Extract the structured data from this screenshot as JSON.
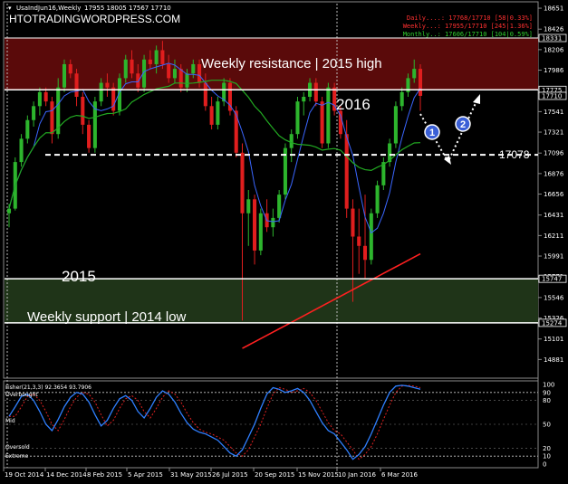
{
  "window": {
    "title": "UsaIndJun16,Weekly",
    "ohlc": "17955 18005 17567 17710",
    "watermark": "HTOTRADINGWORDPRESS.COM"
  },
  "info": [
    {
      "text": "Daily....: 17768/17710 [58|0.33%]",
      "color": "#ff3030"
    },
    {
      "text": "Weekly...: 17955/17710 [245|1.36%]",
      "color": "#ff3030"
    },
    {
      "text": "Monthly..: 17606/17710 [104|0.59%]",
      "color": "#2fd02f"
    }
  ],
  "annotations": {
    "resistance_label": "Weekly resistance | 2015 high",
    "support_label": "Weekly support | 2014 low",
    "year_2016": "2016",
    "year_2015": "2015",
    "level_label": "17078",
    "marker_1": "1",
    "marker_2": "2"
  },
  "oscillator": {
    "title": "Fisher(21,3,3) 92.3654 93.7906",
    "overbought": "Overbought",
    "mid": "Mid",
    "oversold": "Oversold",
    "extreme": "Extreme",
    "ticks": [
      "100",
      "90",
      "80",
      "50",
      "20",
      "10",
      "0"
    ]
  },
  "chart_data": {
    "type": "candlestick",
    "symbol": "UsaIndJun16",
    "timeframe": "Weekly",
    "ylim": [
      14700,
      18700
    ],
    "price_ticks": [
      18651,
      18426,
      18206,
      17986,
      17761,
      17541,
      17321,
      17096,
      16876,
      16656,
      16431,
      16211,
      15991,
      15771,
      15546,
      15326,
      15101,
      14881
    ],
    "price_tags": [
      {
        "value": "18331",
        "price": 18331
      },
      {
        "value": "17775",
        "price": 17775
      },
      {
        "value": "17710",
        "price": 17710
      },
      {
        "value": "15747",
        "price": 15747
      },
      {
        "value": "15274",
        "price": 15274
      }
    ],
    "x_labels": [
      "19 Oct 2014",
      "14 Dec 2014",
      "8 Feb 2015",
      "5 Apr 2015",
      "31 May 2015",
      "26 Jul 2015",
      "20 Sep 2015",
      "15 Nov 2015",
      "10 Jan 2016",
      "6 Mar 2016"
    ],
    "zones": [
      {
        "name": "Weekly resistance | 2015 high",
        "from": 17775,
        "to": 18331,
        "color": "#5a0a0a"
      },
      {
        "name": "Weekly support | 2014 low",
        "from": 15274,
        "to": 15747,
        "color": "#1f3418"
      }
    ],
    "level": 17078,
    "close": 17710,
    "candles": [
      {
        "o": 16450,
        "h": 16550,
        "l": 16300,
        "c": 16500
      },
      {
        "o": 16500,
        "h": 17050,
        "l": 16480,
        "c": 17000
      },
      {
        "o": 17000,
        "h": 17300,
        "l": 16950,
        "c": 17250
      },
      {
        "o": 17250,
        "h": 17500,
        "l": 17200,
        "c": 17450
      },
      {
        "o": 17450,
        "h": 17650,
        "l": 17380,
        "c": 17600
      },
      {
        "o": 17600,
        "h": 17800,
        "l": 17500,
        "c": 17750
      },
      {
        "o": 17750,
        "h": 17800,
        "l": 17600,
        "c": 17650
      },
      {
        "o": 17650,
        "h": 17700,
        "l": 17200,
        "c": 17300
      },
      {
        "o": 17300,
        "h": 17900,
        "l": 17250,
        "c": 17800
      },
      {
        "o": 17800,
        "h": 18100,
        "l": 17750,
        "c": 18050
      },
      {
        "o": 18050,
        "h": 18100,
        "l": 17900,
        "c": 17950
      },
      {
        "o": 17950,
        "h": 18000,
        "l": 17600,
        "c": 17700
      },
      {
        "o": 17700,
        "h": 17750,
        "l": 17300,
        "c": 17400
      },
      {
        "o": 17400,
        "h": 17450,
        "l": 17100,
        "c": 17150
      },
      {
        "o": 17150,
        "h": 17700,
        "l": 17100,
        "c": 17650
      },
      {
        "o": 17650,
        "h": 17900,
        "l": 17600,
        "c": 17850
      },
      {
        "o": 17850,
        "h": 17950,
        "l": 17700,
        "c": 17800
      },
      {
        "o": 17800,
        "h": 17850,
        "l": 17500,
        "c": 17550
      },
      {
        "o": 17550,
        "h": 17950,
        "l": 17500,
        "c": 17900
      },
      {
        "o": 17900,
        "h": 18150,
        "l": 17850,
        "c": 18100
      },
      {
        "o": 18100,
        "h": 18200,
        "l": 17900,
        "c": 17950
      },
      {
        "o": 17950,
        "h": 18050,
        "l": 17750,
        "c": 17800
      },
      {
        "o": 17800,
        "h": 18150,
        "l": 17750,
        "c": 18100
      },
      {
        "o": 18100,
        "h": 18200,
        "l": 18000,
        "c": 18050
      },
      {
        "o": 18050,
        "h": 18250,
        "l": 17950,
        "c": 18200
      },
      {
        "o": 18200,
        "h": 18300,
        "l": 18000,
        "c": 18050
      },
      {
        "o": 18050,
        "h": 18150,
        "l": 17850,
        "c": 17900
      },
      {
        "o": 17900,
        "h": 18100,
        "l": 17850,
        "c": 18000
      },
      {
        "o": 18000,
        "h": 18050,
        "l": 17750,
        "c": 17800
      },
      {
        "o": 17800,
        "h": 18000,
        "l": 17750,
        "c": 17950
      },
      {
        "o": 17950,
        "h": 18100,
        "l": 17900,
        "c": 18050
      },
      {
        "o": 18050,
        "h": 18100,
        "l": 17800,
        "c": 17850
      },
      {
        "o": 17850,
        "h": 17950,
        "l": 17550,
        "c": 17600
      },
      {
        "o": 17600,
        "h": 17700,
        "l": 17350,
        "c": 17400
      },
      {
        "o": 17400,
        "h": 17700,
        "l": 17350,
        "c": 17650
      },
      {
        "o": 17650,
        "h": 17900,
        "l": 17600,
        "c": 17850
      },
      {
        "o": 17850,
        "h": 17900,
        "l": 17500,
        "c": 17550
      },
      {
        "o": 17550,
        "h": 17600,
        "l": 17050,
        "c": 17100
      },
      {
        "o": 17100,
        "h": 17200,
        "l": 15300,
        "c": 16450
      },
      {
        "o": 16450,
        "h": 16700,
        "l": 16100,
        "c": 16600
      },
      {
        "o": 16600,
        "h": 16650,
        "l": 15900,
        "c": 16050
      },
      {
        "o": 16050,
        "h": 16500,
        "l": 16000,
        "c": 16450
      },
      {
        "o": 16450,
        "h": 16600,
        "l": 16250,
        "c": 16300
      },
      {
        "o": 16300,
        "h": 16500,
        "l": 16200,
        "c": 16400
      },
      {
        "o": 16400,
        "h": 16700,
        "l": 16350,
        "c": 16650
      },
      {
        "o": 16650,
        "h": 17200,
        "l": 16600,
        "c": 17150
      },
      {
        "o": 17150,
        "h": 17350,
        "l": 17000,
        "c": 17300
      },
      {
        "o": 17300,
        "h": 17700,
        "l": 17250,
        "c": 17650
      },
      {
        "o": 17650,
        "h": 17750,
        "l": 17500,
        "c": 17700
      },
      {
        "o": 17700,
        "h": 17900,
        "l": 17650,
        "c": 17850
      },
      {
        "o": 17850,
        "h": 17900,
        "l": 17600,
        "c": 17650
      },
      {
        "o": 17650,
        "h": 17700,
        "l": 17150,
        "c": 17200
      },
      {
        "o": 17200,
        "h": 17850,
        "l": 17150,
        "c": 17800
      },
      {
        "o": 17800,
        "h": 17850,
        "l": 17500,
        "c": 17550
      },
      {
        "o": 17550,
        "h": 17600,
        "l": 17250,
        "c": 17300
      },
      {
        "o": 17300,
        "h": 17450,
        "l": 16400,
        "c": 16500
      },
      {
        "o": 16500,
        "h": 16600,
        "l": 15500,
        "c": 16200
      },
      {
        "o": 16200,
        "h": 16500,
        "l": 15800,
        "c": 16100
      },
      {
        "o": 16100,
        "h": 16650,
        "l": 15750,
        "c": 15950
      },
      {
        "o": 15950,
        "h": 16500,
        "l": 15900,
        "c": 16450
      },
      {
        "o": 16450,
        "h": 16800,
        "l": 16400,
        "c": 16750
      },
      {
        "o": 16750,
        "h": 17050,
        "l": 16700,
        "c": 17000
      },
      {
        "o": 17000,
        "h": 17250,
        "l": 16950,
        "c": 17200
      },
      {
        "o": 17200,
        "h": 17650,
        "l": 17150,
        "c": 17600
      },
      {
        "o": 17600,
        "h": 17800,
        "l": 17550,
        "c": 17750
      },
      {
        "o": 17750,
        "h": 17950,
        "l": 17700,
        "c": 17900
      },
      {
        "o": 17900,
        "h": 18100,
        "l": 17850,
        "c": 18000
      },
      {
        "o": 18000,
        "h": 18050,
        "l": 17550,
        "c": 17710
      }
    ],
    "oscillator_values": [
      60,
      72,
      85,
      88,
      80,
      66,
      50,
      42,
      56,
      72,
      84,
      90,
      88,
      78,
      62,
      48,
      55,
      70,
      82,
      86,
      80,
      66,
      58,
      70,
      84,
      92,
      88,
      78,
      64,
      52,
      44,
      40,
      38,
      34,
      30,
      22,
      14,
      10,
      18,
      34,
      50,
      70,
      88,
      96,
      94,
      90,
      92,
      95,
      90,
      80,
      66,
      52,
      42,
      38,
      28,
      18,
      6,
      12,
      22,
      38,
      56,
      74,
      90,
      98,
      99,
      98,
      96,
      94
    ]
  }
}
